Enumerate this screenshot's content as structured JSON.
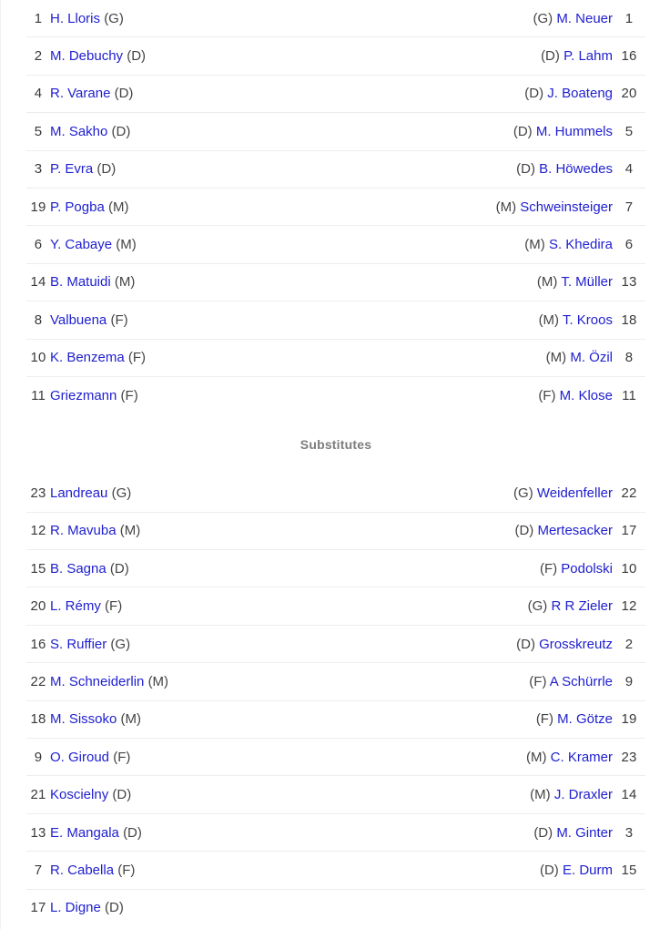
{
  "sections": [
    {
      "id": "starting-lineups",
      "heading": null,
      "rows": [
        {
          "home_num": "1",
          "home_name": "H. Lloris",
          "home_pos": "(G)",
          "away_pos": "(G)",
          "away_name": "M. Neuer",
          "away_num": "1"
        },
        {
          "home_num": "2",
          "home_name": "M. Debuchy",
          "home_pos": "(D)",
          "away_pos": "(D)",
          "away_name": "P. Lahm",
          "away_num": "16"
        },
        {
          "home_num": "4",
          "home_name": "R. Varane",
          "home_pos": "(D)",
          "away_pos": "(D)",
          "away_name": "J. Boateng",
          "away_num": "20"
        },
        {
          "home_num": "5",
          "home_name": "M. Sakho",
          "home_pos": "(D)",
          "away_pos": "(D)",
          "away_name": "M. Hummels",
          "away_num": "5"
        },
        {
          "home_num": "3",
          "home_name": "P. Evra",
          "home_pos": "(D)",
          "away_pos": "(D)",
          "away_name": "B. Höwedes",
          "away_num": "4"
        },
        {
          "home_num": "19",
          "home_name": "P. Pogba",
          "home_pos": "(M)",
          "away_pos": "(M)",
          "away_name": "Schweinsteiger",
          "away_num": "7"
        },
        {
          "home_num": "6",
          "home_name": "Y. Cabaye",
          "home_pos": "(M)",
          "away_pos": "(M)",
          "away_name": "S. Khedira",
          "away_num": "6"
        },
        {
          "home_num": "14",
          "home_name": "B. Matuidi",
          "home_pos": "(M)",
          "away_pos": "(M)",
          "away_name": "T. Müller",
          "away_num": "13"
        },
        {
          "home_num": "8",
          "home_name": "Valbuena",
          "home_pos": "(F)",
          "away_pos": "(M)",
          "away_name": "T. Kroos",
          "away_num": "18"
        },
        {
          "home_num": "10",
          "home_name": "K. Benzema",
          "home_pos": "(F)",
          "away_pos": "(M)",
          "away_name": "M. Özil",
          "away_num": "8"
        },
        {
          "home_num": "11",
          "home_name": "Griezmann",
          "home_pos": "(F)",
          "away_pos": "(F)",
          "away_name": "M. Klose",
          "away_num": "11"
        }
      ]
    },
    {
      "id": "substitutes",
      "heading": "Substitutes",
      "rows": [
        {
          "home_num": "23",
          "home_name": "Landreau",
          "home_pos": "(G)",
          "away_pos": "(G)",
          "away_name": "Weidenfeller",
          "away_num": "22"
        },
        {
          "home_num": "12",
          "home_name": "R. Mavuba",
          "home_pos": "(M)",
          "away_pos": "(D)",
          "away_name": "Mertesacker",
          "away_num": "17"
        },
        {
          "home_num": "15",
          "home_name": "B. Sagna",
          "home_pos": "(D)",
          "away_pos": "(F)",
          "away_name": "Podolski",
          "away_num": "10"
        },
        {
          "home_num": "20",
          "home_name": "L. Rémy",
          "home_pos": "(F)",
          "away_pos": "(G)",
          "away_name": "R R Zieler",
          "away_num": "12"
        },
        {
          "home_num": "16",
          "home_name": "S. Ruffier",
          "home_pos": "(G)",
          "away_pos": "(D)",
          "away_name": "Grosskreutz",
          "away_num": "2"
        },
        {
          "home_num": "22",
          "home_name": "M. Schneiderlin",
          "home_pos": "(M)",
          "away_pos": "(F)",
          "away_name": "A Schürrle",
          "away_num": "9"
        },
        {
          "home_num": "18",
          "home_name": "M. Sissoko",
          "home_pos": "(M)",
          "away_pos": "(F)",
          "away_name": "M. Götze",
          "away_num": "19"
        },
        {
          "home_num": "9",
          "home_name": "O. Giroud",
          "home_pos": "(F)",
          "away_pos": "(M)",
          "away_name": "C. Kramer",
          "away_num": "23"
        },
        {
          "home_num": "21",
          "home_name": "Koscielny",
          "home_pos": "(D)",
          "away_pos": "(M)",
          "away_name": "J. Draxler",
          "away_num": "14"
        },
        {
          "home_num": "13",
          "home_name": "E. Mangala",
          "home_pos": "(D)",
          "away_pos": "(D)",
          "away_name": "M. Ginter",
          "away_num": "3"
        },
        {
          "home_num": "7",
          "home_name": "R. Cabella",
          "home_pos": "(F)",
          "away_pos": "(D)",
          "away_name": "E. Durm",
          "away_num": "15"
        },
        {
          "home_num": "17",
          "home_name": "L. Digne",
          "home_pos": "(D)",
          "away_pos": "",
          "away_name": "",
          "away_num": ""
        }
      ]
    }
  ],
  "colors": {
    "link": "#2020d0",
    "position": "#444444",
    "number": "#3c3c3c",
    "heading": "#7d7d7d",
    "rule": "#ededed",
    "background": "#ffffff"
  }
}
